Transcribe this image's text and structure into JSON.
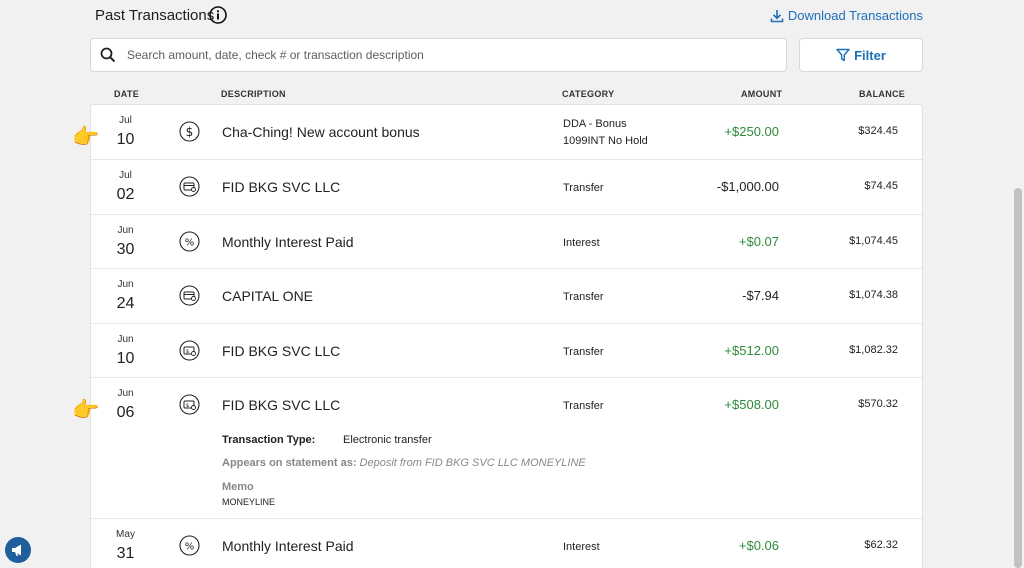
{
  "header": {
    "title": "Past Transactions",
    "download_label": "Download Transactions"
  },
  "search": {
    "placeholder": "Search amount, date, check # or transaction description"
  },
  "filter": {
    "label": "Filter"
  },
  "columns": {
    "date": "DATE",
    "description": "DESCRIPTION",
    "category": "CATEGORY",
    "amount": "AMOUNT",
    "balance": "BALANCE"
  },
  "transactions": [
    {
      "month": "Jul",
      "day": "10",
      "icon": "dollar-circle-icon",
      "description": "Cha-Ching! New account bonus",
      "category_line1": "DDA - Bonus",
      "category_line2": "1099INT No Hold",
      "amount": "+$250.00",
      "balance": "$324.45"
    },
    {
      "month": "Jul",
      "day": "02",
      "icon": "transfer-icon",
      "description": "FID BKG SVC LLC",
      "category_line1": "Transfer",
      "amount": "-$1,000.00",
      "balance": "$74.45"
    },
    {
      "month": "Jun",
      "day": "30",
      "icon": "percent-icon",
      "description": "Monthly Interest Paid",
      "category_line1": "Interest",
      "amount": "+$0.07",
      "balance": "$1,074.45"
    },
    {
      "month": "Jun",
      "day": "24",
      "icon": "transfer-icon",
      "description": "CAPITAL ONE",
      "category_line1": "Transfer",
      "amount": "-$7.94",
      "balance": "$1,074.38"
    },
    {
      "month": "Jun",
      "day": "10",
      "icon": "deposit-icon",
      "description": "FID BKG SVC LLC",
      "category_line1": "Transfer",
      "amount": "+$512.00",
      "balance": "$1,082.32"
    },
    {
      "month": "Jun",
      "day": "06",
      "icon": "deposit-icon",
      "description": "FID BKG SVC LLC",
      "category_line1": "Transfer",
      "amount": "+$508.00",
      "balance": "$570.32"
    },
    {
      "month": "May",
      "day": "31",
      "icon": "percent-icon",
      "description": "Monthly Interest Paid",
      "category_line1": "Interest",
      "amount": "+$0.06",
      "balance": "$62.32"
    }
  ],
  "expanded_details": {
    "type_label": "Transaction Type:",
    "type_value": "Electronic transfer",
    "statement_label": "Appears on statement as:",
    "statement_value": "Deposit from FID BKG SVC LLC MONEYLINE",
    "memo_label": "Memo",
    "memo_value": "MONEYLINE"
  },
  "colors": {
    "accent": "#1c6fb8",
    "positive": "#2f8a3b",
    "pointer": "#f5a623"
  }
}
